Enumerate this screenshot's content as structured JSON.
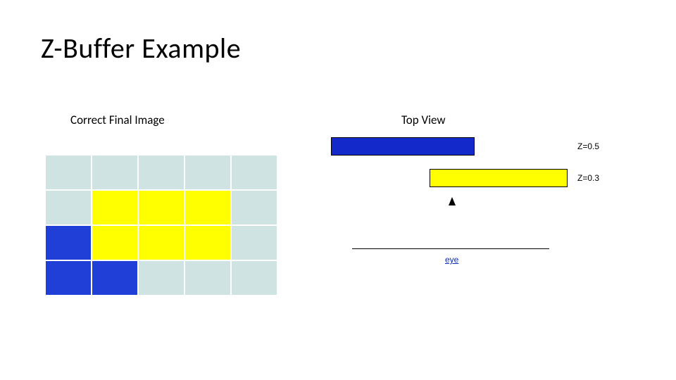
{
  "title": "Z-Buffer  Example",
  "captions": {
    "left": "Correct Final Image",
    "right": "Top View"
  },
  "colors": {
    "background_cell": "#cfe3e3",
    "blue": "#1f3fd6",
    "yellow": "#ffff00",
    "bar_blue": "#1429c9"
  },
  "grid": {
    "cols": 5,
    "rows": 4,
    "cells": [
      [
        "bg",
        "bg",
        "bg",
        "bg",
        "bg"
      ],
      [
        "bg",
        "yel",
        "yel",
        "yel",
        "bg"
      ],
      [
        "blue",
        "yel",
        "yel",
        "yel",
        "bg"
      ],
      [
        "blue",
        "blue",
        "bg",
        "bg",
        "bg"
      ]
    ]
  },
  "top_view": {
    "bars": [
      {
        "color": "blue",
        "z": 0.5,
        "label": "Z=0.5"
      },
      {
        "color": "yellow",
        "z": 0.3,
        "label": "Z=0.3"
      }
    ],
    "eye_label": "eye"
  }
}
